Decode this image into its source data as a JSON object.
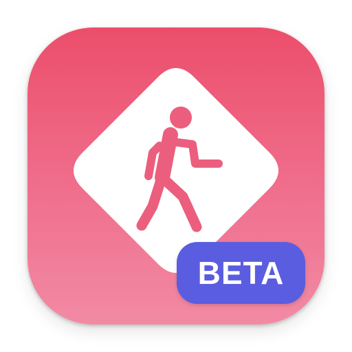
{
  "app_icon": {
    "name": "pedestrian-crossing-app-icon",
    "background_colors": [
      "#ec4e6a",
      "#f28aa4"
    ],
    "sign_color": "#ffffff",
    "figure_color": "#ec5e7d"
  },
  "badge": {
    "label": "BETA",
    "color": "#5a5ddf",
    "text_color": "#ffffff"
  }
}
